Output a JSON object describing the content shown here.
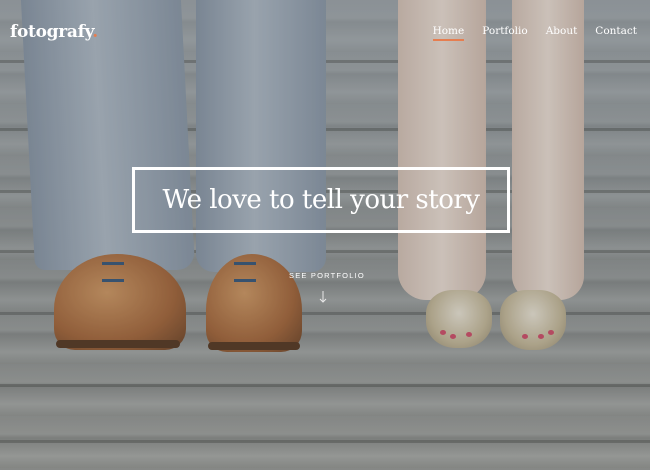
{
  "header": {
    "logo_text": "fotografy",
    "logo_dot": ".",
    "nav": [
      "Home",
      "Portfolio",
      "About",
      "Contact"
    ],
    "active_nav": "Home"
  },
  "hero": {
    "title": "We love to tell your story",
    "cta_label": "SEE PORTFOLIO",
    "scroll_icon": "arrow-down-icon"
  },
  "colors": {
    "accent": "#e67e50",
    "text": "#ffffff"
  }
}
